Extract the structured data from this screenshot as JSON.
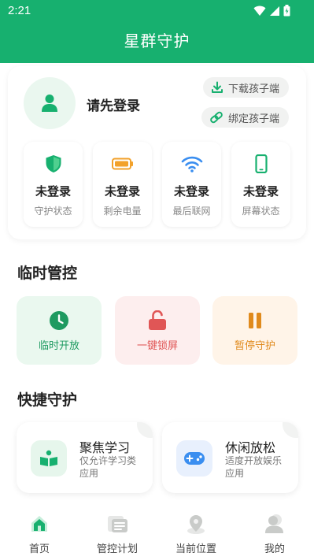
{
  "status_bar": {
    "time": "2:21"
  },
  "app_bar": {
    "title": "星群守护"
  },
  "account": {
    "login_prompt": "请先登录",
    "download_label": "下载孩子端",
    "bind_label": "绑定孩子端"
  },
  "status_tiles": [
    {
      "icon": "shield-icon",
      "value": "未登录",
      "label": "守护状态"
    },
    {
      "icon": "battery-icon",
      "value": "未登录",
      "label": "剩余电量"
    },
    {
      "icon": "wifi-icon",
      "value": "未登录",
      "label": "最后联网"
    },
    {
      "icon": "phone-icon",
      "value": "未登录",
      "label": "屏幕状态"
    }
  ],
  "temp_control": {
    "title": "临时管控",
    "items": [
      {
        "icon": "clock-icon",
        "label": "临时开放",
        "color": "#1e9a60"
      },
      {
        "icon": "lock-icon",
        "label": "一键锁屏",
        "color": "#e05656"
      },
      {
        "icon": "pause-icon",
        "label": "暂停守护",
        "color": "#e08a1c"
      }
    ]
  },
  "quick_guard": {
    "title": "快捷守护",
    "items": [
      {
        "icon": "book-icon",
        "title": "聚焦学习",
        "desc": "仅允许学习类应用"
      },
      {
        "icon": "gamepad-icon",
        "title": "休闲放松",
        "desc": "适度开放娱乐应用"
      }
    ]
  },
  "tabs": [
    {
      "icon": "home-icon",
      "label": "首页"
    },
    {
      "icon": "schedule-icon",
      "label": "管控计划"
    },
    {
      "icon": "location-icon",
      "label": "当前位置"
    },
    {
      "icon": "profile-icon",
      "label": "我的"
    }
  ],
  "colors": {
    "primary": "#17b06f"
  }
}
